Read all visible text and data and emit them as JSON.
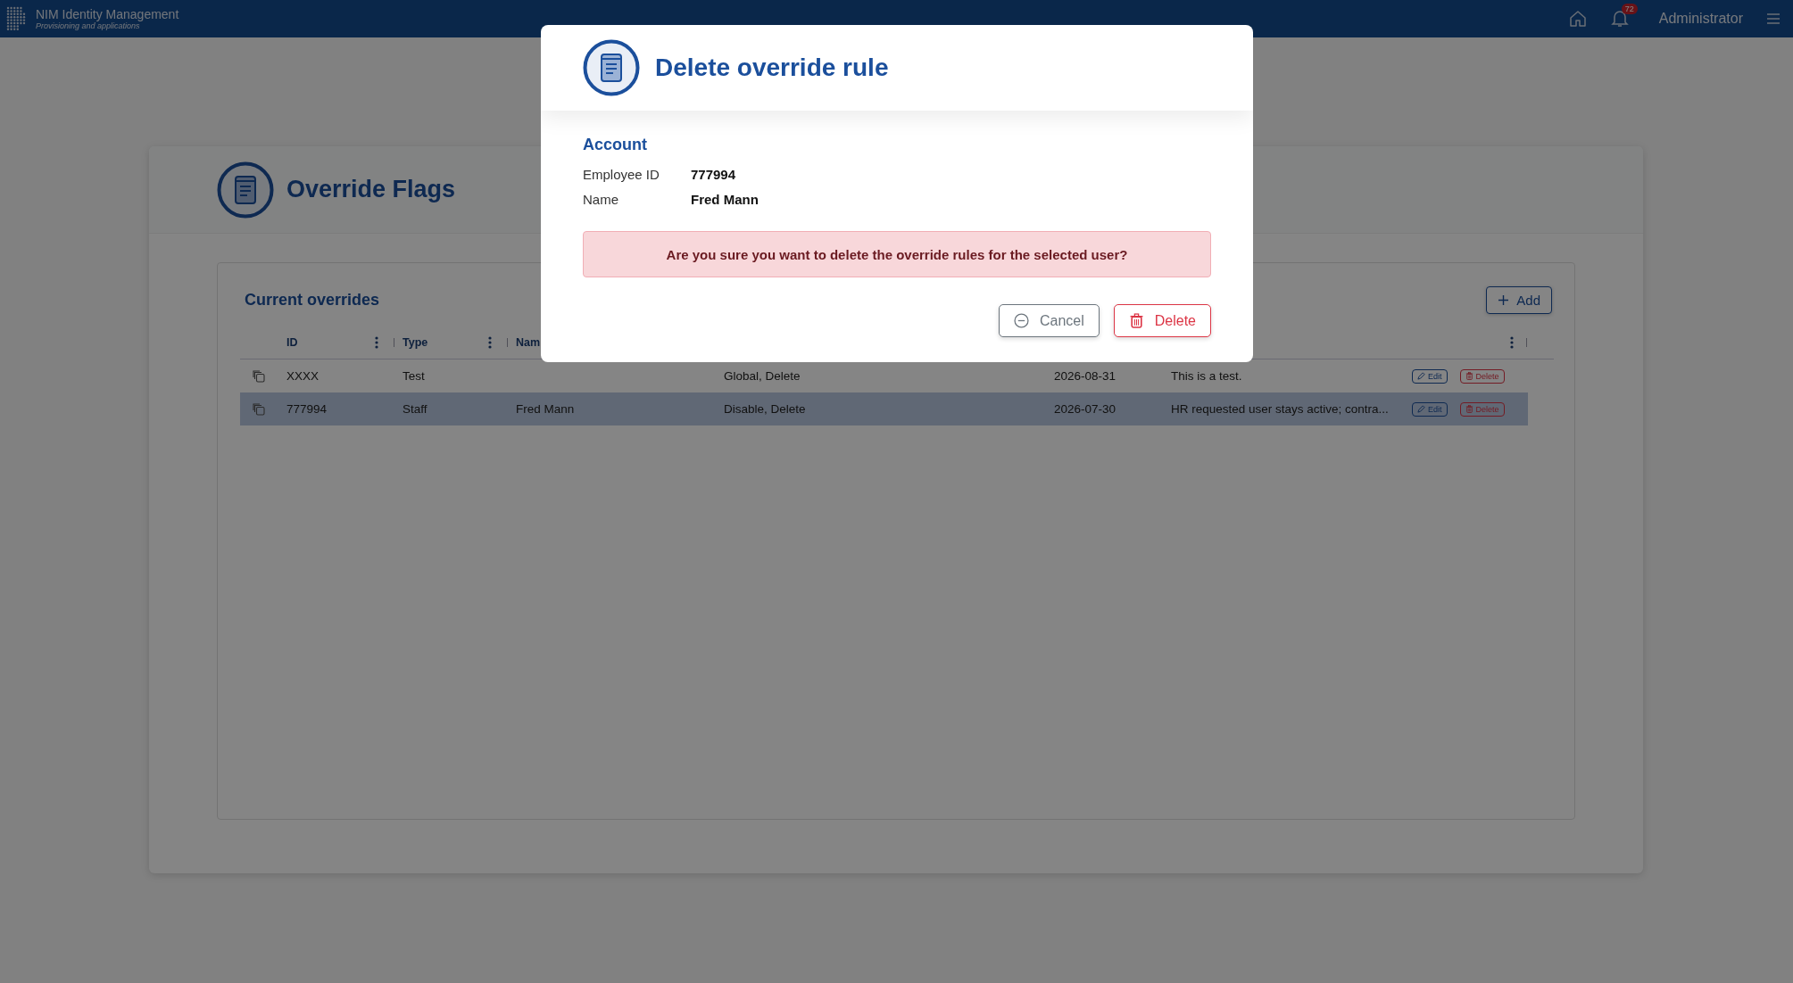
{
  "header": {
    "app_title": "NIM Identity Management",
    "subtitle": "Provisioning and applications",
    "notification_count": "72",
    "user": "Administrator"
  },
  "page": {
    "title": "Override Flags"
  },
  "panel": {
    "title": "Current overrides",
    "add_button": "Add",
    "columns": [
      {
        "label": "ID"
      },
      {
        "label": "Type"
      },
      {
        "label": "Nam"
      }
    ],
    "rows": [
      {
        "id": "XXXX",
        "type": "Test",
        "column_4": "Global, Delete",
        "column_5": "2026-08-31",
        "column_6": "This is a test.",
        "edit": "Edit",
        "delete": "Delete",
        "selected": false
      },
      {
        "id": "777994",
        "type": "Staff",
        "name": "Fred Mann",
        "column_4": "Disable, Delete",
        "column_5": "2026-07-30",
        "column_6": "HR requested user stays active; contra...",
        "edit": "Edit",
        "delete": "Delete",
        "selected": true
      }
    ]
  },
  "modal": {
    "title": "Delete override rule",
    "section": "Account",
    "fields": [
      {
        "label": "Employee ID",
        "value": "777994"
      },
      {
        "label": "Name",
        "value": "Fred Mann"
      }
    ],
    "message": "Are you sure you want to delete the override rules for the selected user?",
    "buttons": [
      {
        "label": "Cancel",
        "kind": "cancel"
      },
      {
        "label": "Delete",
        "kind": "delete"
      }
    ]
  }
}
